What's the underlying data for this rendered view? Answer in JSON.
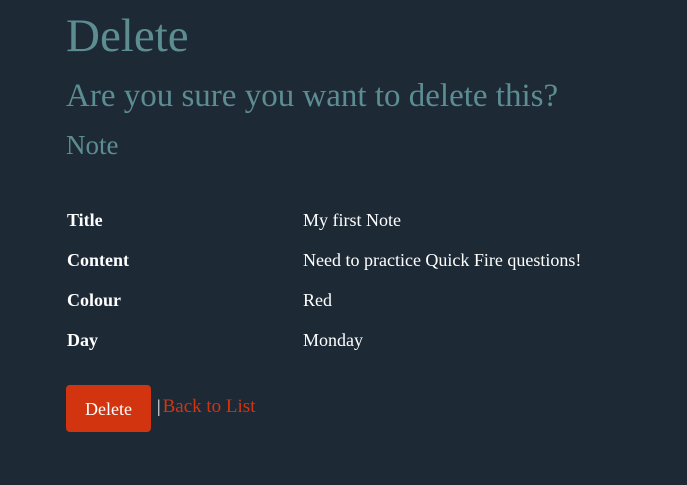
{
  "page": {
    "title": "Delete",
    "confirm_message": "Are you sure you want to delete this?",
    "entity_name": "Note"
  },
  "details": [
    {
      "label": "Title",
      "value": "My first Note"
    },
    {
      "label": "Content",
      "value": "Need to practice Quick Fire questions!"
    },
    {
      "label": "Colour",
      "value": "Red"
    },
    {
      "label": "Day",
      "value": "Monday"
    }
  ],
  "actions": {
    "delete_label": "Delete",
    "separator": "|",
    "back_label": "Back to List"
  },
  "colors": {
    "background": "#1e2936",
    "heading": "#5b8d91",
    "danger": "#d2340f",
    "text": "#ffffff"
  }
}
